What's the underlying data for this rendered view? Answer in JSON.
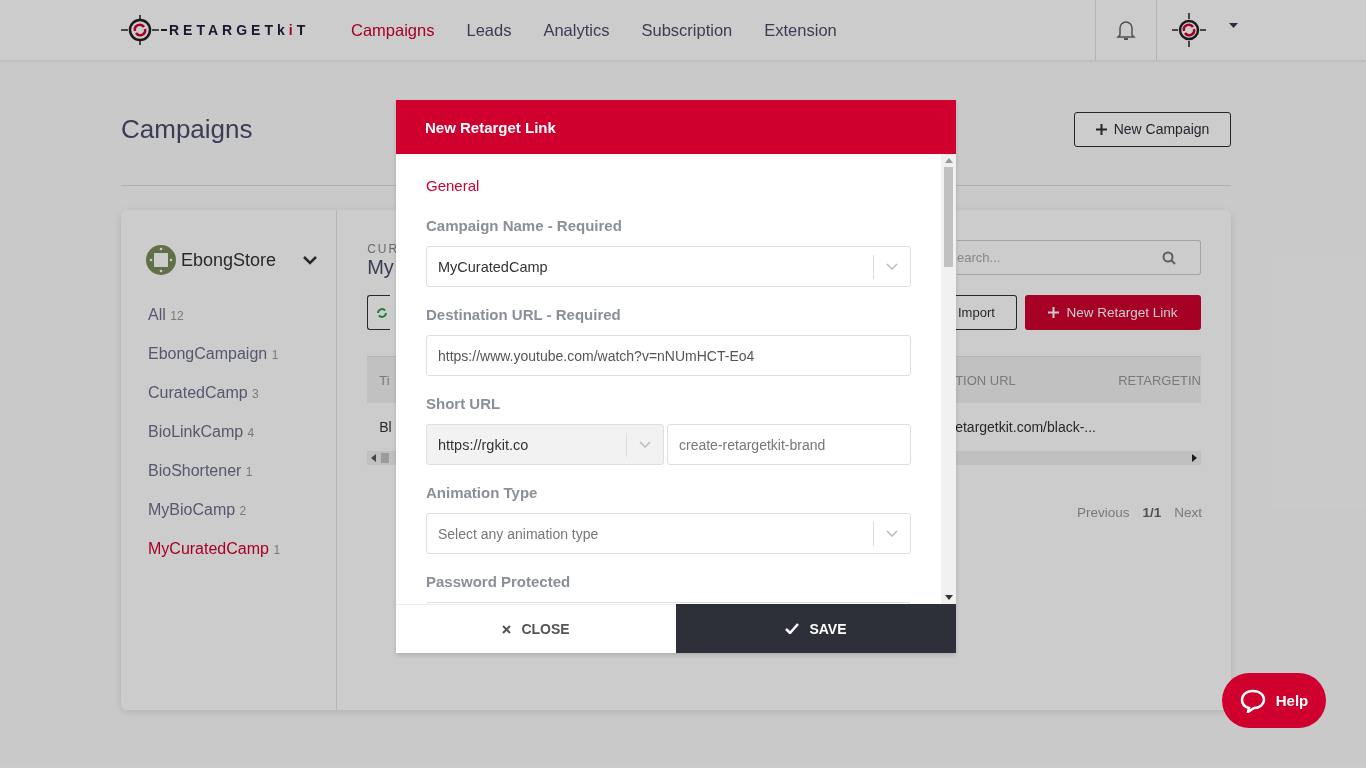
{
  "header": {
    "logo": [
      {
        "text": "RETARGETk",
        "accent": false
      },
      {
        "text": "i",
        "accent": true
      },
      {
        "text": "T",
        "accent": false
      }
    ],
    "nav": [
      {
        "label": "Campaigns",
        "selected": true
      },
      {
        "label": "Leads",
        "selected": false
      },
      {
        "label": "Analytics",
        "selected": false
      },
      {
        "label": "Subscription",
        "selected": false
      },
      {
        "label": "Extension",
        "selected": false
      }
    ]
  },
  "page": {
    "title": "Campaigns",
    "new_campaign": "New Campaign"
  },
  "sidebar": {
    "store": "EbongStore",
    "items": [
      {
        "label": "All",
        "count": "12",
        "selected": false
      },
      {
        "label": "EbongCampaign",
        "count": "1",
        "selected": false
      },
      {
        "label": "CuratedCamp",
        "count": "3",
        "selected": false
      },
      {
        "label": "BioLinkCamp",
        "count": "4",
        "selected": false
      },
      {
        "label": "BioShortener",
        "count": "1",
        "selected": false
      },
      {
        "label": "MyBioCamp",
        "count": "2",
        "selected": false
      },
      {
        "label": "MyCuratedCamp",
        "count": "1",
        "selected": true
      }
    ]
  },
  "content": {
    "label": "CUR",
    "title": "My",
    "search": {
      "placeholder": "earch..."
    },
    "import": "Import",
    "new_link": "New Retarget Link",
    "table": {
      "columns": [
        "Ti",
        "TION URL",
        "RETARGETIN"
      ],
      "rows": [
        [
          "Bl",
          "etargetkit.com/black-..."
        ]
      ]
    },
    "pagination": {
      "previous": "Previous",
      "page": "1/1",
      "next": "Next"
    }
  },
  "modal": {
    "title": "New Retarget Link",
    "section": "General",
    "fields": [
      {
        "kind": "select",
        "label": "Campaign Name - Required",
        "value": "MyCuratedCamp"
      },
      {
        "kind": "input",
        "label": "Destination URL - Required",
        "value": "https://www.youtube.com/watch?v=nNUmHCT-Eo4"
      },
      {
        "kind": "split",
        "label": "Short URL",
        "value": "https://rgkit.co",
        "placeholder": "create-retargetkit-brand"
      },
      {
        "kind": "select",
        "label": "Animation Type",
        "placeholder": "Select any animation type"
      },
      {
        "kind": "input",
        "label": "Password Protected"
      }
    ],
    "close": "CLOSE",
    "save": "SAVE"
  },
  "help": "Help"
}
